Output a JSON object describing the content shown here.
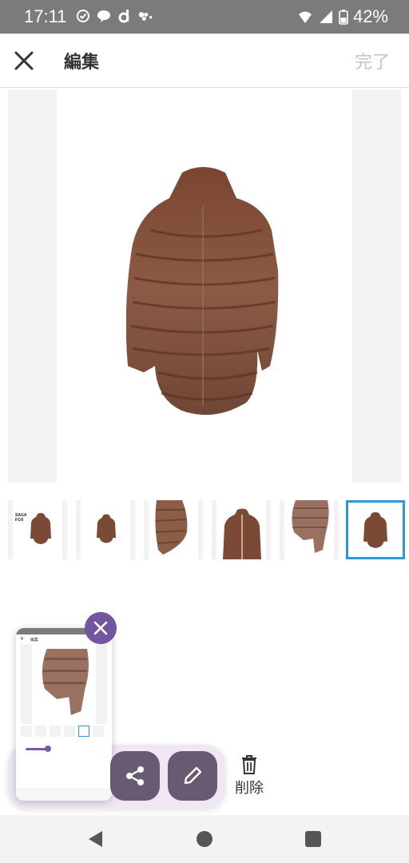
{
  "status_bar": {
    "time": "17:11",
    "battery": "42%",
    "icons": [
      "check-circle-icon",
      "line-icon",
      "d-icon",
      "game-icon",
      "wifi-icon",
      "signal-icon",
      "battery-icon"
    ]
  },
  "app_bar": {
    "title": "編集",
    "done_label": "完了",
    "close_icon": "close-icon"
  },
  "thumbnails": [
    {
      "kind": "fur-coat-with-text",
      "text_left": "SAGA FOX",
      "selected": false
    },
    {
      "kind": "fur-coat-back",
      "selected": false
    },
    {
      "kind": "fur-sleeve-closeup",
      "selected": false
    },
    {
      "kind": "fur-coat-front",
      "selected": false
    },
    {
      "kind": "fur-coat-side",
      "selected": false
    },
    {
      "kind": "fur-coat-back",
      "selected": true
    }
  ],
  "float_card": {
    "mini_title": "編集",
    "dismiss_icon": "close-icon",
    "share_icon": "share-icon",
    "edit_icon": "pencil-icon"
  },
  "delete": {
    "label": "削除",
    "icon": "trash-icon"
  },
  "nav_bar": {
    "icons": [
      "back-icon",
      "home-icon",
      "recents-icon"
    ]
  },
  "colors": {
    "status_bar": "#7b7b7b",
    "accent": "#7355a0",
    "selected_border": "#2a9bd8",
    "action_button": "#675a72"
  }
}
